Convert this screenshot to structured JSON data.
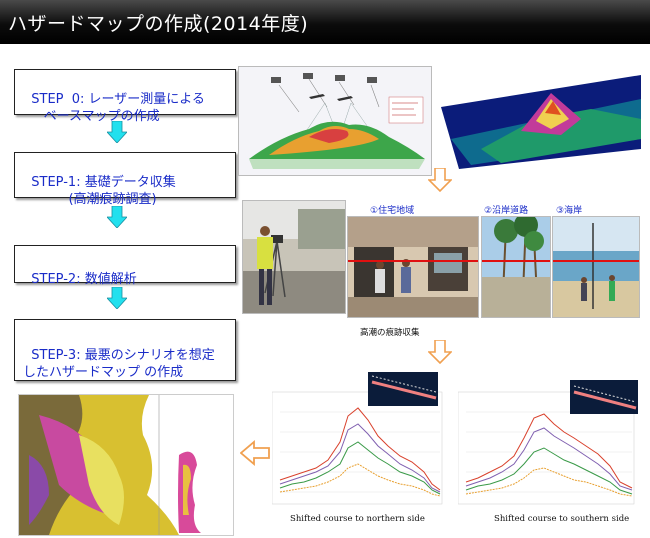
{
  "title": "ハザードマップの作成(2014年度)",
  "steps": [
    {
      "text": "STEP  0: レーザー測量による\n     ベースマップの作成"
    },
    {
      "text": "STEP-1: 基礎データ収集\n           (高潮痕跡調査)"
    },
    {
      "text": "STEP-2: 数値解析"
    },
    {
      "text": "STEP-3: 最悪のシナリオを想定\nしたハザードマップ の作成"
    }
  ],
  "survey": {
    "labels": [
      "①住宅地域",
      "②沿岸道路",
      "③海岸"
    ],
    "caption": "高潮の痕跡収集"
  },
  "charts": [
    {
      "caption": "Shifted course to northern side"
    },
    {
      "caption": "Shifted course to southern side"
    }
  ],
  "colors": {
    "step_text": "#1a2cc8",
    "arrow_fill": "#22e0ee",
    "orange_arrow": "#f0a050",
    "trace_line": "#e01010"
  }
}
